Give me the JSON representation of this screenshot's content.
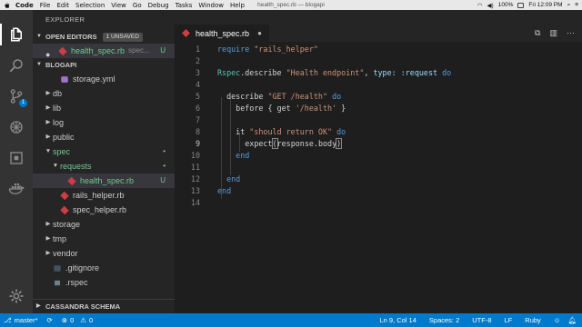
{
  "menubar": {
    "items": [
      "Code",
      "File",
      "Edit",
      "Selection",
      "View",
      "Go",
      "Debug",
      "Tasks",
      "Window",
      "Help"
    ],
    "window_title": "health_spec.rb — blogapi",
    "battery": "100%",
    "time": "Fri 12:09 PM"
  },
  "activity": {
    "extensions_badge": "1"
  },
  "sidebar": {
    "title": "EXPLORER",
    "open_editors": {
      "label": "OPEN EDITORS",
      "badge": "1 UNSAVED",
      "file": "health_spec.rb",
      "path": "spec...",
      "status": "U"
    },
    "project": "BLOGAPI",
    "tree": [
      {
        "name": "storage.yml",
        "kind": "yml",
        "depth": 2,
        "caret": "",
        "status": ""
      },
      {
        "name": "db",
        "kind": "folder",
        "depth": 1,
        "caret": "▶",
        "status": ""
      },
      {
        "name": "lib",
        "kind": "folder",
        "depth": 1,
        "caret": "▶",
        "status": ""
      },
      {
        "name": "log",
        "kind": "folder",
        "depth": 1,
        "caret": "▶",
        "status": ""
      },
      {
        "name": "public",
        "kind": "folder",
        "depth": 1,
        "caret": "▶",
        "status": ""
      },
      {
        "name": "spec",
        "kind": "folder-green",
        "depth": 1,
        "caret": "▼",
        "status": "•"
      },
      {
        "name": "requests",
        "kind": "folder-green",
        "depth": 2,
        "caret": "▼",
        "status": "•"
      },
      {
        "name": "health_spec.rb",
        "kind": "ruby-green",
        "depth": 3,
        "caret": "",
        "status": "U"
      },
      {
        "name": "rails_helper.rb",
        "kind": "ruby",
        "depth": 2,
        "caret": "",
        "status": ""
      },
      {
        "name": "spec_helper.rb",
        "kind": "ruby",
        "depth": 2,
        "caret": "",
        "status": ""
      },
      {
        "name": "storage",
        "kind": "folder",
        "depth": 1,
        "caret": "▶",
        "status": ""
      },
      {
        "name": "tmp",
        "kind": "folder",
        "depth": 1,
        "caret": "▶",
        "status": ""
      },
      {
        "name": "vendor",
        "kind": "folder",
        "depth": 1,
        "caret": "▶",
        "status": ""
      },
      {
        "name": ".gitignore",
        "kind": "git",
        "depth": 1,
        "caret": "",
        "status": ""
      },
      {
        "name": ".rspec",
        "kind": "rspec",
        "depth": 1,
        "caret": "",
        "status": ""
      }
    ],
    "cassandra": "CASSANDRA SCHEMA"
  },
  "editor": {
    "tab_label": "health_spec.rb",
    "line_numbers": [
      "1",
      "2",
      "3",
      "4",
      "5",
      "6",
      "7",
      "8",
      "9",
      "10",
      "11",
      "12",
      "13",
      "14"
    ],
    "lines": [
      [
        {
          "t": "require ",
          "c": "kw"
        },
        {
          "t": "\"rails_helper\"",
          "c": "st"
        }
      ],
      [],
      [
        {
          "t": "Rspec",
          "c": "cn"
        },
        {
          "t": ".describe ",
          "c": "pl"
        },
        {
          "t": "\"Health endpoint\"",
          "c": "st"
        },
        {
          "t": ", ",
          "c": "pl"
        },
        {
          "t": "type: :request",
          "c": "sy"
        },
        {
          "t": " do",
          "c": "kw"
        }
      ],
      [],
      [
        {
          "t": "  describe ",
          "c": "pl"
        },
        {
          "t": "\"GET /health\"",
          "c": "st"
        },
        {
          "t": " do",
          "c": "kw"
        }
      ],
      [
        {
          "t": "    before { get ",
          "c": "pl"
        },
        {
          "t": "'/health'",
          "c": "st"
        },
        {
          "t": " }",
          "c": "pl"
        }
      ],
      [],
      [
        {
          "t": "    it ",
          "c": "pl"
        },
        {
          "t": "\"should return OK\"",
          "c": "st"
        },
        {
          "t": " do",
          "c": "kw"
        }
      ],
      [
        {
          "t": "      expect",
          "c": "pl"
        },
        {
          "t": "(",
          "c": "hl"
        },
        {
          "t": "response.body",
          "c": "pl"
        },
        {
          "t": ")",
          "c": "hl"
        }
      ],
      [
        {
          "t": "    end",
          "c": "kw"
        }
      ],
      [],
      [
        {
          "t": "  end",
          "c": "kw"
        }
      ],
      [
        {
          "t": "end",
          "c": "kw"
        }
      ],
      []
    ]
  },
  "statusbar": {
    "branch": "master*",
    "errors": "0",
    "warnings": "0",
    "position": "Ln 9, Col 14",
    "spaces": "Spaces: 2",
    "encoding": "UTF-8",
    "eol": "LF",
    "language": "Ruby"
  }
}
